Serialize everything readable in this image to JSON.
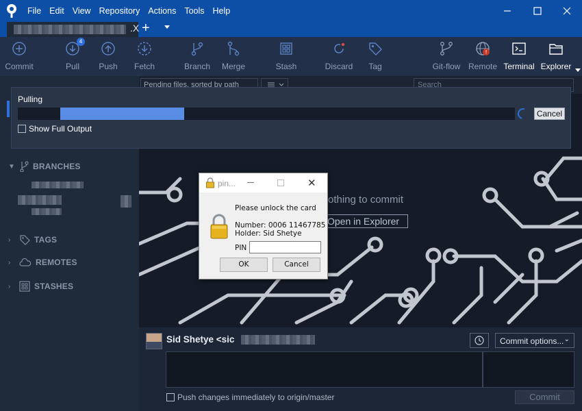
{
  "menu": [
    "File",
    "Edit",
    "View",
    "Repository",
    "Actions",
    "Tools",
    "Help"
  ],
  "window_controls": {
    "minimize": "–",
    "maximize": "☐",
    "close": "✕"
  },
  "tabs": {
    "close_glyph": ".X",
    "add_glyph": "+"
  },
  "toolbar": {
    "commit": "Commit",
    "pull": "Pull",
    "pull_badge": "4",
    "push": "Push",
    "fetch": "Fetch",
    "branch": "Branch",
    "merge": "Merge",
    "stash": "Stash",
    "discard": "Discard",
    "tag": "Tag",
    "gitflow": "Git-flow",
    "remote": "Remote",
    "terminal": "Terminal",
    "explorer": "Explorer"
  },
  "filter": {
    "pending": "Pending files, sorted by path",
    "search": "Search"
  },
  "pull_panel": {
    "title": "Pulling",
    "cancel": "Cancel",
    "show_full_output": "Show Full Output",
    "progress_fraction": 0.25
  },
  "sidebar": {
    "branches": "BRANCHES",
    "tags": "TAGS",
    "remotes": "REMOTES",
    "stashes": "STASHES"
  },
  "main": {
    "nothing_to_commit": "othing to commit",
    "open_in_explorer": "Open in Explorer"
  },
  "commit": {
    "author": "Sid Shetye <sic",
    "commit_options": "Commit options...",
    "push_immediately": "Push changes immediately to origin/master",
    "commit_button": "Commit"
  },
  "dialog": {
    "title": "pin...",
    "prompt": "Please unlock the card",
    "number": "Number: 0006 11467785",
    "holder": "Holder: Sid Shetye",
    "pin_label": "PIN",
    "ok": "OK",
    "cancel": "Cancel"
  },
  "colors": {
    "titlebar": "#0d4ea6",
    "toolbar": "#223049",
    "progress": "#5a8ee6",
    "circuit": "#c2c7cf"
  }
}
